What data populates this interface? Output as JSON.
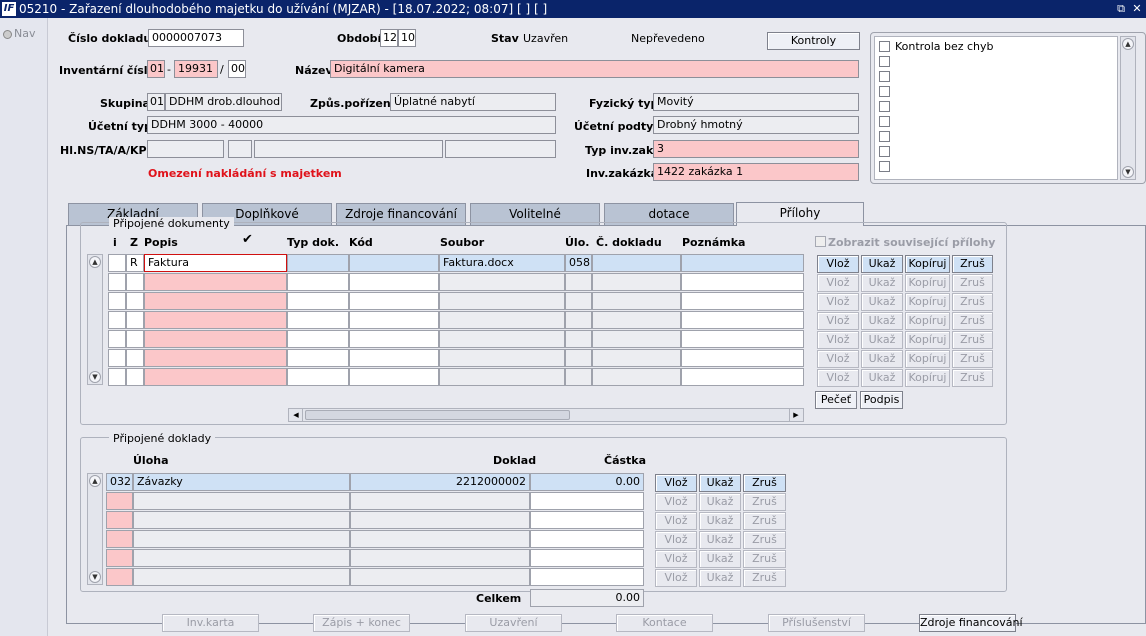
{
  "window": {
    "title": "05210 - Zařazení dlouhodobého majetku do užívání (MJZAR) - [18.07.2022; 08:07] [ ] [ ]",
    "logo": "IF",
    "restore_glyph": "⧉",
    "close_glyph": "✕"
  },
  "nav": {
    "label": "Nav"
  },
  "header": {
    "cislo_dokladu_label": "Číslo dokladu",
    "cislo_dokladu_value": "0000007073",
    "obdobi_label": "Období",
    "obdobi_month": "12",
    "obdobi_year": "10",
    "stav_label": "Stav",
    "stav_value": "Uzavřen",
    "neprevedeno": "Nepřevedeno",
    "kontroly_button": "Kontroly",
    "inv_cislo_label": "Inventární číslo",
    "inv_part1": "01",
    "inv_dash": "-",
    "inv_part2": "19931",
    "inv_slash": "/",
    "inv_part3": "00",
    "nazev_label": "Název",
    "nazev_value": "Digitální kamera",
    "skupina_label": "Skupina",
    "skupina_code": "01",
    "skupina_value": "DDHM drob.dlouhod.hm",
    "zpus_label": "Způs.pořízení",
    "zpus_value": "Úplatné nabytí",
    "fyz_typ_label": "Fyzický typ",
    "fyz_typ_value": "Movitý",
    "ucetni_typ_label": "Účetní typ",
    "ucetni_typ_value": "DDHM 3000 - 40000",
    "ucetni_podtyp_label": "Účetní podtyp",
    "ucetni_podtyp_value": "Drobný hmotný",
    "hlns_label": "Hl.NS/TA/A/KP",
    "typ_inv_label": "Typ inv.zak.",
    "typ_inv_value": "3",
    "omezeni": "Omezení nakládání s majetkem",
    "inv_zakazka_label": "Inv.zakázka",
    "inv_zakazka_value": "1422 zakázka 1"
  },
  "checklist": {
    "first_item": "Kontrola bez chyb"
  },
  "tabs": [
    {
      "label": "Základní"
    },
    {
      "label": "Doplňkové"
    },
    {
      "label": "Zdroje financování"
    },
    {
      "label": "Volitelné"
    },
    {
      "label": "dotace"
    },
    {
      "label": "Přílohy"
    }
  ],
  "dokumenty": {
    "group_title": "Připojené dokumenty",
    "columns": {
      "i": "i",
      "z": "Z",
      "popis": "Popis",
      "check": "✔",
      "typ": "Typ dok.",
      "kod": "Kód",
      "soubor": "Soubor",
      "ulo": "Úlo.",
      "cdokladu": "Č. dokladu",
      "poznamka": "Poznámka"
    },
    "row1": {
      "z": "R",
      "popis": "Faktura",
      "soubor": "Faktura.docx",
      "ulo": "058"
    },
    "zobrazit_label": "Zobrazit související přílohy",
    "btn_vloz": "Vlož",
    "btn_ukaz": "Ukaž",
    "btn_kopiruj": "Kopíruj",
    "btn_zrus": "Zruš",
    "btn_pecet": "Pečeť",
    "btn_podpis": "Podpis"
  },
  "doklady": {
    "group_title": "Připojené doklady",
    "columns": {
      "uloha": "Úloha",
      "doklad": "Doklad",
      "castka": "Částka"
    },
    "row1": {
      "code": "032",
      "uloha": "Závazky",
      "doklad": "2212000002",
      "castka": "0.00"
    },
    "celkem_label": "Celkem",
    "celkem_value": "0.00",
    "btn_vloz": "Vlož",
    "btn_ukaz": "Ukaž",
    "btn_zrus": "Zruš"
  },
  "bottom_buttons": {
    "inv_karta": "Inv.karta",
    "zapis": "Zápis + konec",
    "uzavreni": "Uzavření",
    "kontace": "Kontace",
    "prislusenstvi": "Příslušenství",
    "zdroje": "Zdroje financování"
  }
}
